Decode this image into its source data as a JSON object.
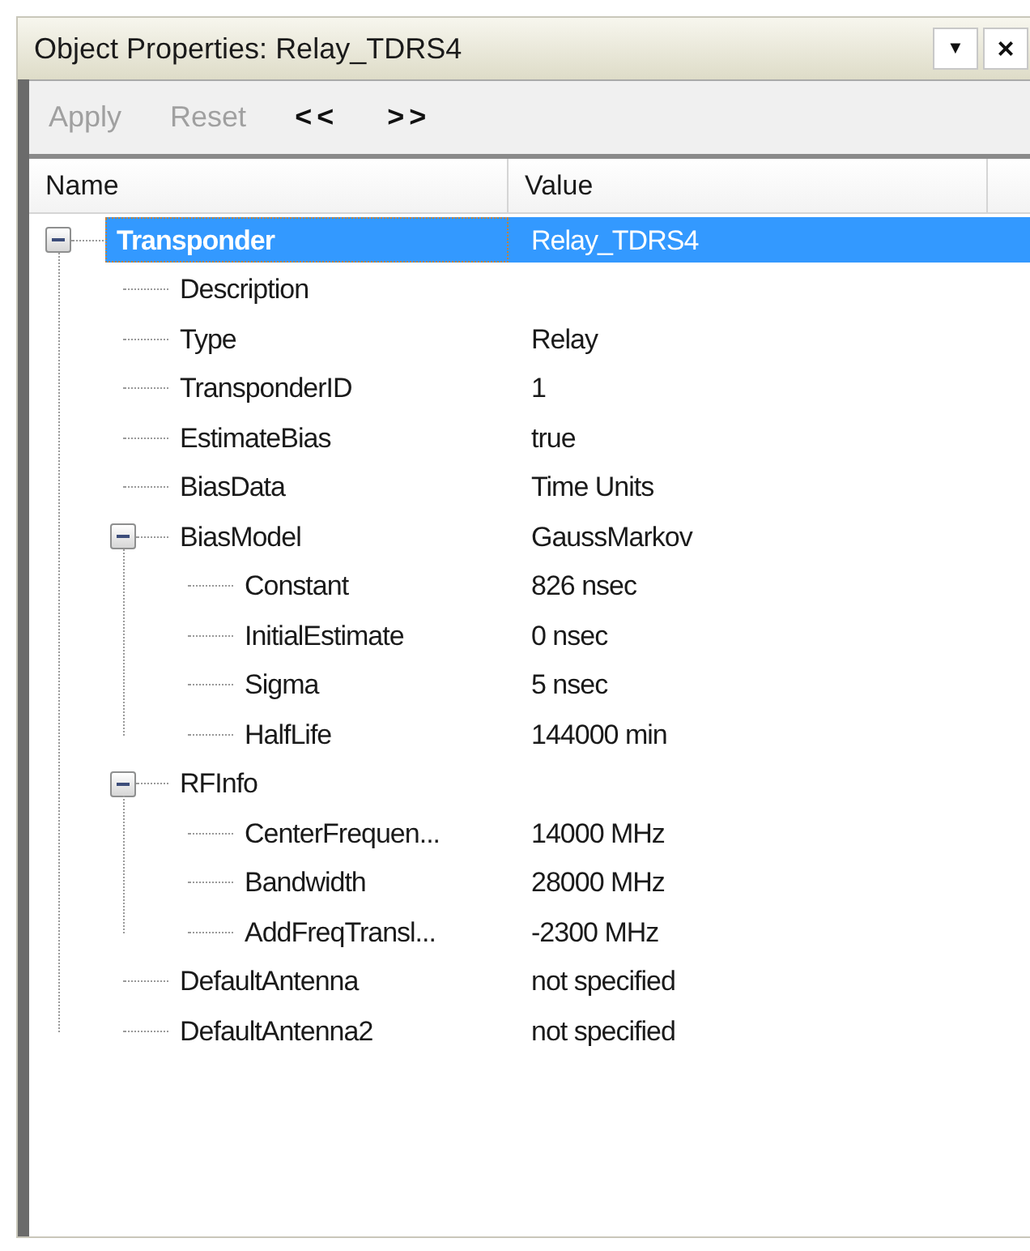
{
  "window": {
    "title": "Object Properties: Relay_TDRS4",
    "controls": [
      {
        "kind": "menu",
        "label": "▼"
      },
      {
        "kind": "close",
        "label": "×"
      }
    ]
  },
  "toolbar": [
    {
      "label": "Apply",
      "disabled": true
    },
    {
      "label": "Reset",
      "disabled": true
    },
    {
      "label": "<<",
      "disabled": false
    },
    {
      "label": ">>",
      "disabled": false
    }
  ],
  "columns": [
    "Name",
    "Value"
  ],
  "tree": [
    {
      "name": "Transponder",
      "value": "Relay_TDRS4",
      "selected": true,
      "expanded": true,
      "children": [
        {
          "name": "Description",
          "selected": false
        },
        {
          "name": "Type",
          "value": "Relay",
          "selected": false
        },
        {
          "name": "TransponderID",
          "value": "1",
          "selected": false
        },
        {
          "name": "EstimateBias",
          "value": "true",
          "selected": false
        },
        {
          "name": "BiasData",
          "value": "Time Units",
          "selected": false
        },
        {
          "name": "BiasModel",
          "value": "GaussMarkov",
          "selected": false,
          "expanded": true,
          "children": [
            {
              "name": "Constant",
              "value": "826 nsec",
              "selected": false
            },
            {
              "name": "InitialEstimate",
              "value": "0 nsec",
              "selected": false
            },
            {
              "name": "Sigma",
              "value": "5 nsec",
              "selected": false
            },
            {
              "name": "HalfLife",
              "value": "144000 min",
              "selected": false
            }
          ]
        },
        {
          "name": "RFInfo",
          "selected": false,
          "expanded": true,
          "children": [
            {
              "name": "CenterFrequen...",
              "value": "14000 MHz",
              "selected": false
            },
            {
              "name": "Bandwidth",
              "value": "28000 MHz",
              "selected": false
            },
            {
              "name": "AddFreqTransl...",
              "value": "-2300 MHz",
              "selected": false
            }
          ]
        },
        {
          "name": "DefaultAntenna",
          "value": "not specified",
          "selected": false
        },
        {
          "name": "DefaultAntenna2",
          "value": "not specified",
          "selected": false
        }
      ]
    }
  ]
}
